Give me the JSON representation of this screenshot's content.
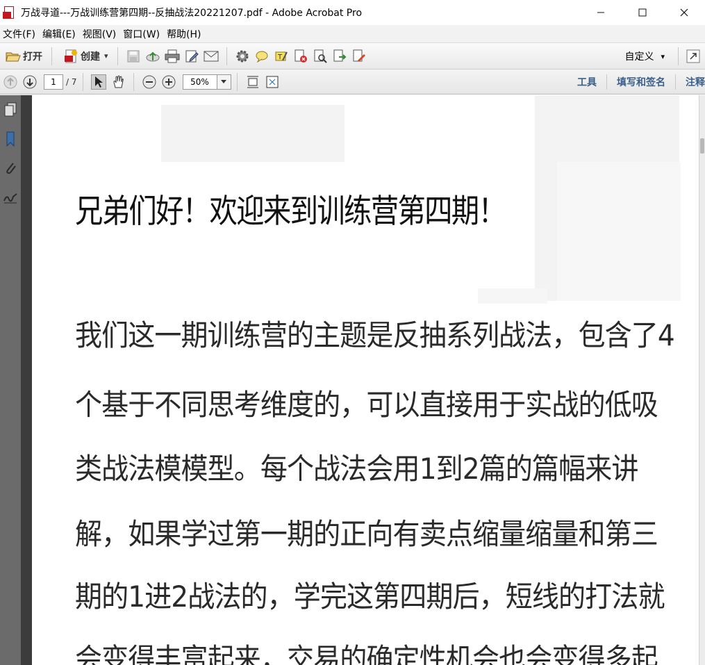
{
  "window": {
    "title": "万战寻道---万战训练营第四期--反抽战法20221207.pdf - Adobe Acrobat Pro",
    "minimize_icon": "minimize-icon",
    "maximize_icon": "maximize-icon",
    "close_icon": "close-icon"
  },
  "menu": {
    "items": [
      {
        "label": "文件(F)"
      },
      {
        "label": "编辑(E)"
      },
      {
        "label": "视图(V)"
      },
      {
        "label": "窗口(W)"
      },
      {
        "label": "帮助(H)"
      }
    ]
  },
  "toolbar": {
    "open_label": "打开",
    "create_label": "创建",
    "create_dropdown": "▾",
    "customize_label": "自定义",
    "customize_dropdown": "▾"
  },
  "nav_toolbar": {
    "current_page": "1",
    "total_pages": "/ 7",
    "zoom_value": "50%"
  },
  "side_links": {
    "tools": "工具",
    "fill_sign": "填写和签名",
    "comment": "注释"
  },
  "document": {
    "heading": "兄弟们好！欢迎来到训练营第四期！",
    "lines": [
      "我们这一期训练营的主题是反抽系列战法，包含了4",
      "个基于不同思考维度的，可以直接用于实战的低吸",
      "类战法模模型。每个战法会用1到2篇的篇幅来讲",
      "解，如果学过第一期的正向有卖点缩量缩量和第三",
      "期的1进2战法的，学完这第四期后，短线的打法就",
      "会变得丰富起来，交易的确定性机会也会变得多起"
    ]
  },
  "colors": {
    "accent_link": "#3a5f8a",
    "nav_pane": "#6b6b6b",
    "gutter": "#3c3c3c",
    "acrobat_red": "#c4161c"
  }
}
